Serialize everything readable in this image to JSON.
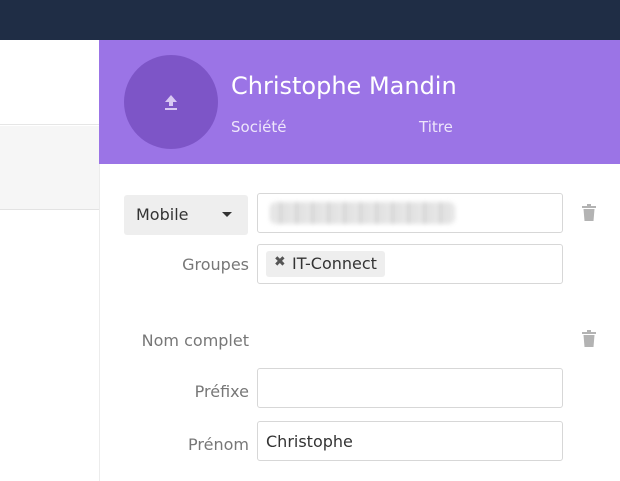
{
  "header": {
    "contact_name": "Christophe Mandin",
    "company_placeholder": "Société",
    "title_placeholder": "Titre",
    "avatar_icon": "upload-icon",
    "header_color": "#9b74e6"
  },
  "phone": {
    "type": "Mobile",
    "value_obscured": true
  },
  "groups": {
    "label": "Groupes",
    "tags": [
      "IT-Connect"
    ],
    "remove_icon": "close-icon"
  },
  "fullname": {
    "label": "Nom complet"
  },
  "prefix": {
    "label": "Préfixe",
    "value": ""
  },
  "firstname": {
    "label": "Prénom",
    "value": "Christophe"
  },
  "icons": {
    "delete": "trash-icon"
  },
  "colors": {
    "topbar": "#1f2d45",
    "accent": "#9b74e6",
    "avatar": "#7d55c7"
  }
}
